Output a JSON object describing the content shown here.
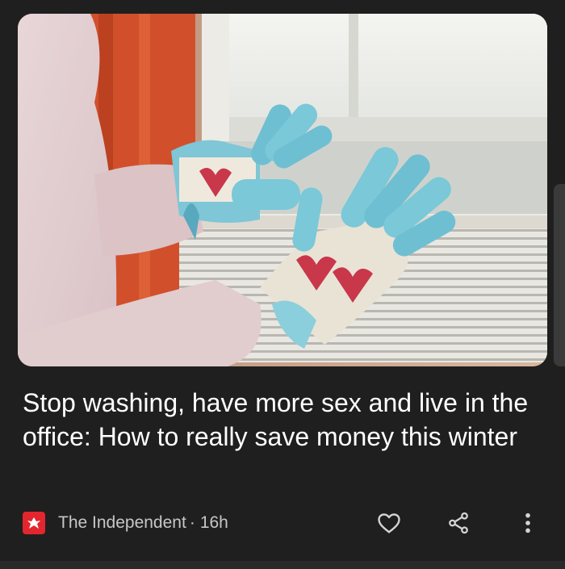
{
  "article": {
    "image_alt": "Hands in knitted blue gloves warming near a radiator by a window",
    "headline": "Stop washing, have more sex and live in the office: How to really save money this winter",
    "publisher": "The Independent",
    "separator": "·",
    "age": "16h"
  },
  "actions": {
    "like_icon": "heart-outline-icon",
    "share_icon": "share-icon",
    "more_icon": "more-vertical-icon"
  },
  "colors": {
    "background": "#1f1f1f",
    "headline": "#ffffff",
    "meta_text": "#c7c7c7",
    "publisher_brand": "#e3262e"
  }
}
